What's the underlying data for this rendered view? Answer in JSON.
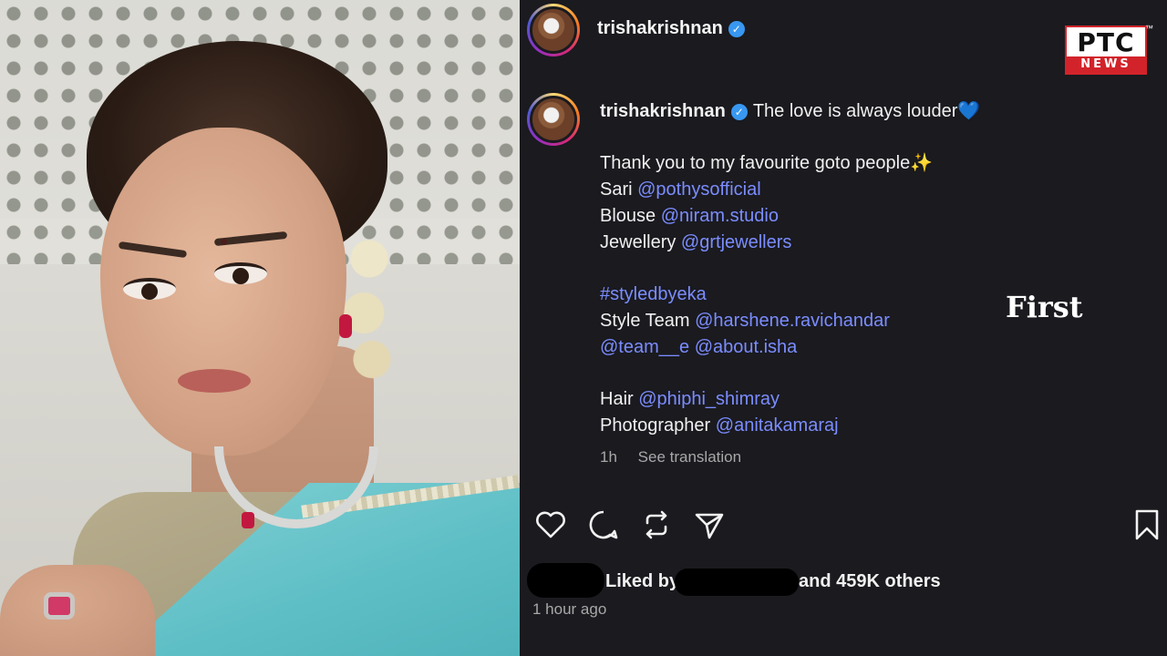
{
  "post": {
    "header_username": "trishakrishnan",
    "caption_username": "trishakrishnan",
    "caption_headline": "The love is always louder💙",
    "lines": [
      {
        "label": "Thank you to my favourite goto people✨",
        "link": ""
      },
      {
        "label": "Sari ",
        "link": "@pothysofficial"
      },
      {
        "label": "Blouse ",
        "link": "@niram.studio"
      },
      {
        "label": "Jewellery ",
        "link": "@grtjewellers"
      }
    ],
    "hashtag": "#styledbyeka",
    "style_team_label": "Style Team ",
    "style_team_link": "@harshene.ravichandar",
    "team_links": "@team__e @about.isha",
    "hair_label": "Hair ",
    "hair_link": "@phiphi_shimray",
    "photographer_label": "Photographer ",
    "photographer_link": "@anitakamaraj",
    "age_short": "1h",
    "see_translation": "See translation",
    "liked_by": "Liked by",
    "and_others": "and 459K others",
    "time_ago": "1 hour ago"
  },
  "overlay": {
    "first_label": "First",
    "logo_top": "PTC",
    "logo_bottom": "NEWS",
    "logo_tm": "™"
  },
  "icons": {
    "verified": "verified-badge-icon",
    "like": "heart-icon",
    "comment": "comment-icon",
    "repost": "repost-icon",
    "share": "send-icon",
    "save": "bookmark-icon"
  },
  "colors": {
    "link": "#7b8dff",
    "panel_bg": "#1a1a1f",
    "verified": "#3897f0",
    "ptc_red": "#d2232a"
  }
}
